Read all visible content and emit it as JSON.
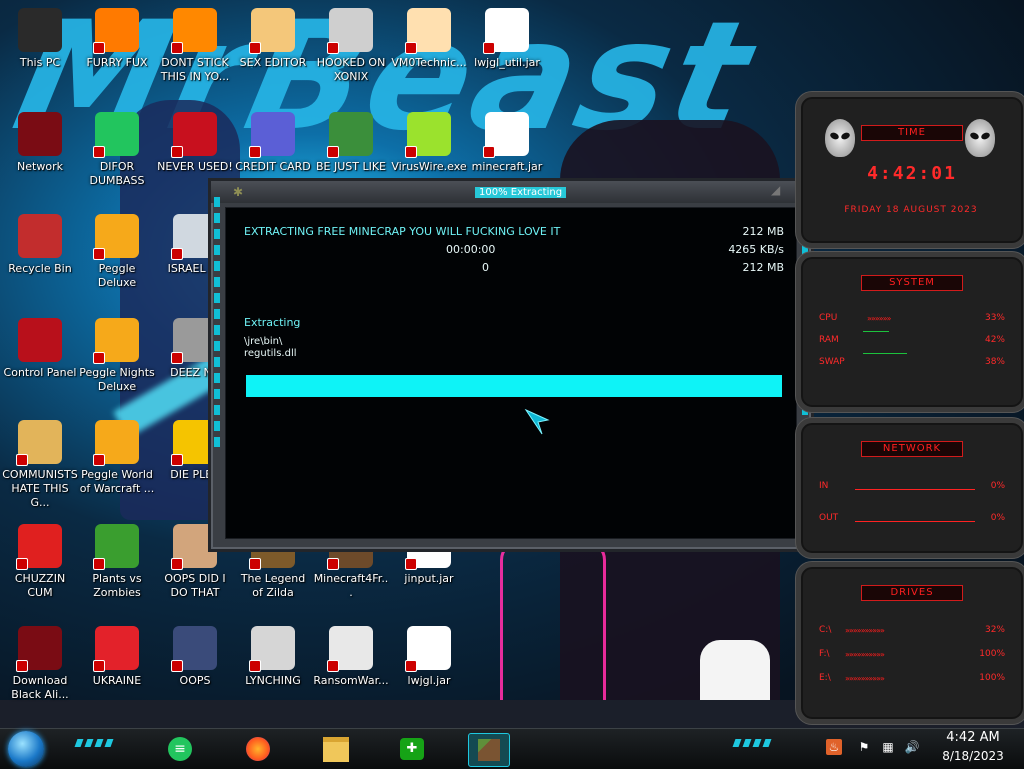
{
  "desktop_icons": [
    {
      "label": "This PC",
      "icon": "monitor-icon",
      "color": "#2a2a2a"
    },
    {
      "label": "FURRY FUX",
      "icon": "firefox-icon",
      "color": "#ff7a00"
    },
    {
      "label": "DONT STICK THIS IN YO...",
      "icon": "vlc-cone-icon",
      "color": "#ff8800"
    },
    {
      "label": "SEX EDITOR",
      "icon": "hxd-icon",
      "color": "#f4c77a"
    },
    {
      "label": "HOOKED ON XONIX",
      "icon": "xonix-icon",
      "color": "#cfcfcf"
    },
    {
      "label": "VM0Technic...",
      "icon": "doctor-icon",
      "color": "#ffe0b0"
    },
    {
      "label": "lwjgl_util.jar",
      "icon": "java-icon",
      "color": "#ffffff"
    },
    {
      "label": "Network",
      "icon": "alien-orb-icon",
      "color": "#7a0c14"
    },
    {
      "label": "DIFOR DUMBASS",
      "icon": "notes-icon",
      "color": "#22c55e"
    },
    {
      "label": "NEVER USED!",
      "icon": "devcpp-icon",
      "color": "#c8101e"
    },
    {
      "label": "CREDIT CARD",
      "icon": "credit-card-icon",
      "color": "#5b5fd6"
    },
    {
      "label": "BE JUST LIKE",
      "icon": "santa-icon",
      "color": "#3b8f3b"
    },
    {
      "label": "VirusWire.exe",
      "icon": "lime-icon",
      "color": "#9be22d"
    },
    {
      "label": "minecraft.jar",
      "icon": "java-icon",
      "color": "#ffffff"
    },
    {
      "label": "Recycle Bin",
      "icon": "recycle-bin-icon",
      "color": "#c22d2d"
    },
    {
      "label": "Peggle Deluxe",
      "icon": "peggle-icon",
      "color": "#f6a91a"
    },
    {
      "label": "ISRAEL SF",
      "icon": "network-drive-icon",
      "color": "#d0d8e0"
    },
    {
      "label": "Control Panel",
      "icon": "control-panel-icon",
      "color": "#b8101b"
    },
    {
      "label": "Peggle Nights Deluxe",
      "icon": "peggle-icon",
      "color": "#f6a91a"
    },
    {
      "label": "DEEZ NU",
      "icon": "stacked-windows-icon",
      "color": "#9a9a9a"
    },
    {
      "label": "COMMUNISTS HATE THIS G...",
      "icon": "money-bag-icon",
      "color": "#e2b45a"
    },
    {
      "label": "Peggle World of Warcraft ...",
      "icon": "peggle-icon",
      "color": "#f6a91a"
    },
    {
      "label": "DIE PLEA",
      "icon": "die-icon",
      "color": "#f5c400"
    },
    {
      "label": "CHUZZIN CUM",
      "icon": "chuzzle-icon",
      "color": "#e0201f"
    },
    {
      "label": "Plants vs Zombies",
      "icon": "pvz-icon",
      "color": "#3a9e2f"
    },
    {
      "label": "OOPS DID I DO THAT",
      "icon": "portrait-icon",
      "color": "#d2a57c"
    },
    {
      "label": "The Legend of Zilda",
      "icon": "zelda-icon",
      "color": "#7d5a2a"
    },
    {
      "label": "Minecraft4Fr...",
      "icon": "minecraft-icon",
      "color": "#6d4a2a"
    },
    {
      "label": "jinput.jar",
      "icon": "java-icon",
      "color": "#ffffff"
    },
    {
      "label": "Download Black Ali...",
      "icon": "alien-orb-icon",
      "color": "#7a0c14"
    },
    {
      "label": "UKRAINE",
      "icon": "radiation-icon",
      "color": "#e3222a"
    },
    {
      "label": "OOPS",
      "icon": "terminal-icon",
      "color": "#3a4b7a"
    },
    {
      "label": "LYNCHING",
      "icon": "knot-icon",
      "color": "#d6d6d6"
    },
    {
      "label": "RansomWar...",
      "icon": "skull-icon",
      "color": "#e8e8e8"
    },
    {
      "label": "lwjgl.jar",
      "icon": "java-icon",
      "color": "#ffffff"
    }
  ],
  "wallpaper": {
    "title": "MrBeast"
  },
  "dialog": {
    "title": "100% Extracting",
    "heading": "EXTRACTING FREE MINECRAP YOU WILL FUCKING LOVE IT",
    "size_total": "212 MB",
    "time_left": "00:00:00",
    "speed": "4265 KB/s",
    "processed_count": "0",
    "size_done": "212 MB",
    "status_label": "Extracting",
    "path_line1": "\\jre\\bin\\",
    "path_line2": "regutils.dll",
    "progress_percent": 100,
    "accent_color": "#0ef3f7"
  },
  "gadget": {
    "time": {
      "header": "TIME",
      "clock": "4:42:01",
      "date": "FRIDAY 18 AUGUST 2023"
    },
    "system": {
      "header": "SYSTEM",
      "rows": [
        {
          "label": "CPU",
          "value": "33%"
        },
        {
          "label": "RAM",
          "value": "42%"
        },
        {
          "label": "SWAP",
          "value": "38%"
        }
      ]
    },
    "network": {
      "header": "NETWORK",
      "rows": [
        {
          "label": "IN",
          "value": "0%"
        },
        {
          "label": "OUT",
          "value": "0%"
        }
      ]
    },
    "drives": {
      "header": "DRIVES",
      "rows": [
        {
          "label": "C:\\",
          "value": "32%"
        },
        {
          "label": "F:\\",
          "value": "100%"
        },
        {
          "label": "E:\\",
          "value": "100%"
        }
      ]
    },
    "accent_color": "#ff2a2a"
  },
  "taskbar": {
    "pinned": [
      {
        "name": "notes-app",
        "icon": "notes-icon"
      },
      {
        "name": "firefox",
        "icon": "firefox-icon"
      },
      {
        "name": "file-explorer",
        "icon": "folder-icon"
      },
      {
        "name": "xbox",
        "icon": "xbox-icon"
      },
      {
        "name": "minecraft",
        "icon": "minecraft-block-icon"
      }
    ],
    "tray_icons": [
      "java-update-icon",
      "flag-icon",
      "network-icon",
      "volume-icon"
    ],
    "time": "4:42 AM",
    "date": "8/18/2023"
  }
}
